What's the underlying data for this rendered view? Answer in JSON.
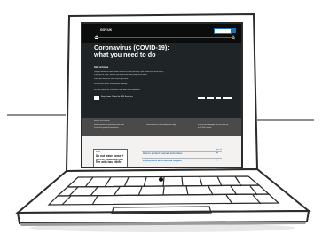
{
  "header": {
    "logo_text": "GOV.UK",
    "search": {
      "placeholder": ""
    }
  },
  "hero": {
    "title": "Coronavirus (COVID-19):\nwhat you need to do",
    "heading": "Stay at home",
    "bullets": [
      "Only go outside for food, health reasons or work (but only if you cannot work from home)",
      "If you go out, stay 2 metres (6ft) away from other people at all times",
      "Wash your hands as soon as you get home"
    ],
    "infection_note": "Do not meet others, even friends or family.",
    "infection_note_2": "You can spread the virus even if you don't have symptoms.",
    "slogan": "Stay at home. Protect the NHS. Save lives."
  },
  "announcement": {
    "title": "Announcement",
    "columns": [
      "Boris Johnson has announced new rules to stop the spread of coronavirus",
      "Find out how to claim statutory sick pay",
      "If you're self-employed, you can claim up to £2,500 a month"
    ]
  },
  "content": {
    "info_box_heading": "NHS",
    "info_box_text": "Do not leave home if you or someone you live with has either:",
    "open_all": "Open all",
    "accordion": [
      "How to protect yourself and others",
      "Employment and financial support"
    ]
  },
  "colors": {
    "header": "#0b0c0c",
    "hero": "#1f2527",
    "link_blue": "#1d70b8",
    "body_bg": "#f3f2f1"
  }
}
